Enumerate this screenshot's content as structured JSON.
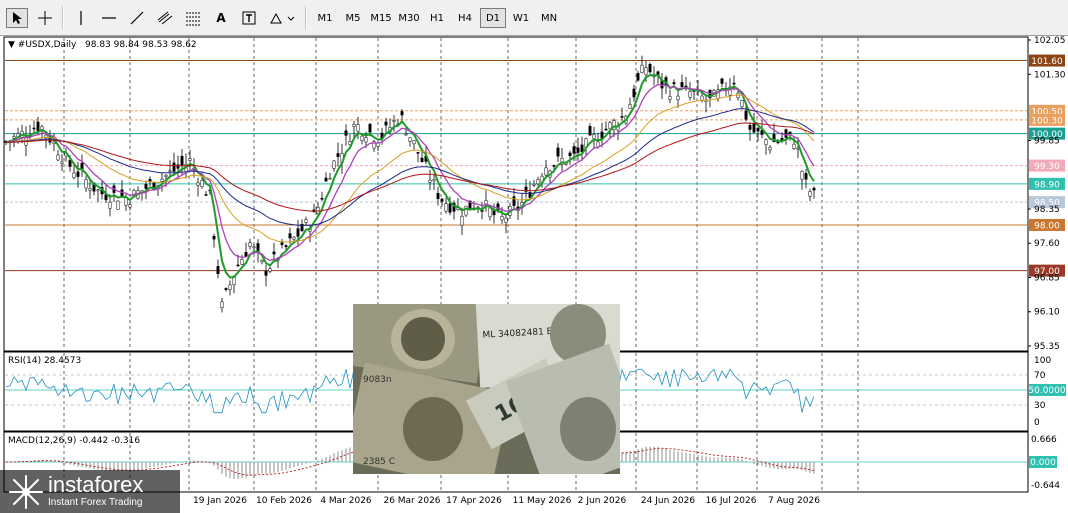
{
  "toolbar": {
    "tools": [
      {
        "name": "cursor-tool",
        "icon": "arrow-cursor-icon"
      },
      {
        "name": "crosshair-tool",
        "icon": "crosshair-icon"
      },
      {
        "name": "vertical-line-tool",
        "icon": "vertical-line-icon"
      },
      {
        "name": "horizontal-line-tool",
        "icon": "horizontal-line-icon"
      },
      {
        "name": "trendline-tool",
        "icon": "trendline-icon"
      },
      {
        "name": "channel-tool",
        "icon": "channel-icon"
      },
      {
        "name": "fibonacci-tool",
        "icon": "fibonacci-icon"
      },
      {
        "name": "text-tool",
        "icon": "text-icon"
      },
      {
        "name": "text-label-tool",
        "icon": "text-label-icon"
      },
      {
        "name": "shapes-tool",
        "icon": "shapes-icon"
      }
    ],
    "text_tool_glyph": "A",
    "timeframes": [
      "M1",
      "M5",
      "M15",
      "M30",
      "H1",
      "H4",
      "D1",
      "W1",
      "MN"
    ],
    "active_timeframe": "D1"
  },
  "chart": {
    "symbol_label": "#USDX,Daily",
    "ohlc": "98.83 98.84 98.53 98.62",
    "price_ticks": [
      "102.05",
      "101.30",
      "99.85",
      "98.35",
      "97.60",
      "96.85",
      "96.10",
      "95.35"
    ],
    "level_labels": [
      {
        "text": "101.60",
        "price": 101.6,
        "color": "#8b4513"
      },
      {
        "text": "100.50",
        "price": 100.5,
        "color": "#e8a060"
      },
      {
        "text": "100.30",
        "price": 100.3,
        "color": "#e8a060"
      },
      {
        "text": "100.00",
        "price": 100.0,
        "color": "#1aa090"
      },
      {
        "text": "99.30",
        "price": 99.3,
        "color": "#f2aab8"
      },
      {
        "text": "98.90",
        "price": 98.9,
        "color": "#2fc0b0"
      },
      {
        "text": "98.50",
        "price": 98.5,
        "color": "#b8c8d8"
      },
      {
        "text": "98.00",
        "price": 98.0,
        "color": "#c87830"
      },
      {
        "text": "97.00",
        "price": 97.0,
        "color": "#9a3a28"
      }
    ],
    "date_labels": [
      "19 Jan 2026",
      "10 Feb 2026",
      "4 Mar 2026",
      "26 Mar 2026",
      "17 Apr 2026",
      "11 May 2026",
      "2 Jun 2026",
      "24 Jun 2026",
      "16 Jul 2026",
      "7 Aug 2026"
    ]
  },
  "rsi": {
    "label": "RSI(14) 28.4573",
    "ticks": [
      "100",
      "70",
      "30",
      "0"
    ],
    "level_label": "50.0000"
  },
  "macd": {
    "label": "MACD(12,26,9) -0.442 -0.316",
    "ticks": [
      "0.666",
      "-0.644"
    ],
    "zero_label": "0.000"
  },
  "watermark": {
    "brand": "instaforex",
    "tagline": "Instant Forex Trading"
  },
  "colors": {
    "ma_green": "#1f9a2a",
    "ma_purple": "#b040c0",
    "ma_navy": "#1a2a8a",
    "ma_red": "#b01818",
    "ma_orange": "#d8a020",
    "rsi_line": "#2090c0",
    "macd_signal": "#c01818"
  }
}
